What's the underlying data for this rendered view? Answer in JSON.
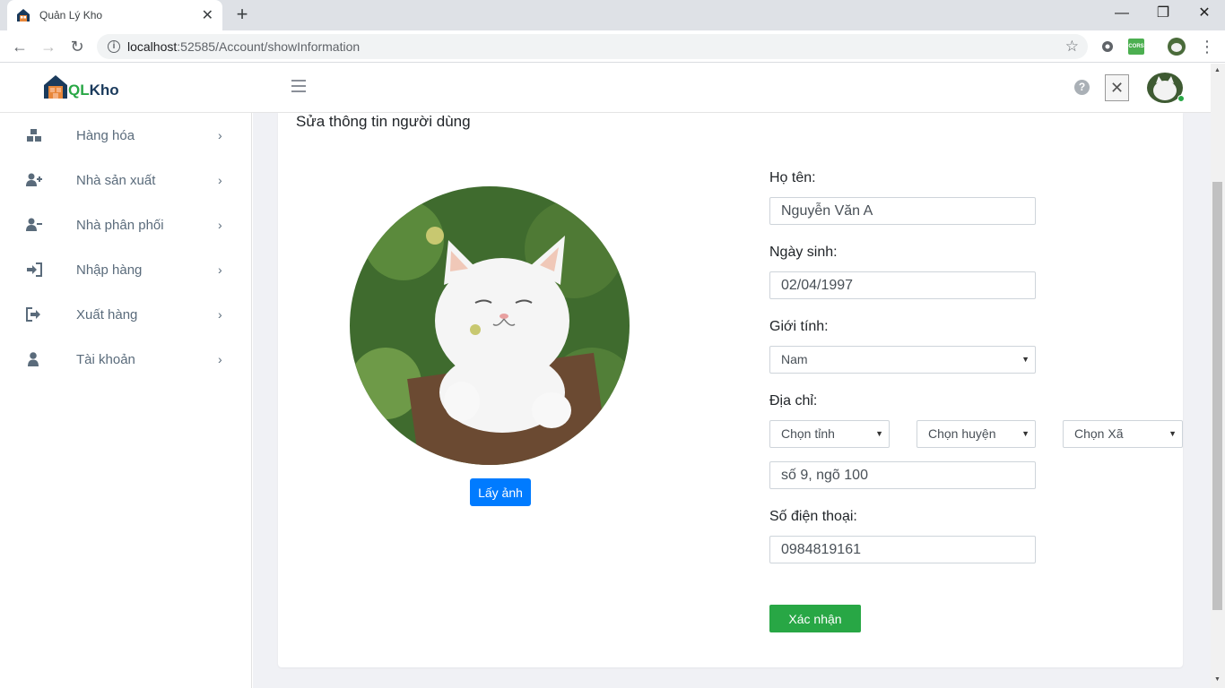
{
  "browser": {
    "tab_title": "Quản Lý Kho",
    "url_host": "localhost",
    "url_path": ":52585/Account/showInformation",
    "new_tab": "+",
    "ext_cors_label": "CORS"
  },
  "header": {
    "logo_q": "QL",
    "logo_k": "Kho",
    "help": "?",
    "close": "✕"
  },
  "sidebar": {
    "items": [
      {
        "label": "Hàng hóa",
        "icon": "boxes-icon"
      },
      {
        "label": "Nhà sản xuất",
        "icon": "user-plus-icon"
      },
      {
        "label": "Nhà phân phối",
        "icon": "user-minus-icon"
      },
      {
        "label": "Nhập hàng",
        "icon": "sign-in-icon"
      },
      {
        "label": "Xuất hàng",
        "icon": "sign-out-icon"
      },
      {
        "label": "Tài khoản",
        "icon": "user-icon"
      }
    ],
    "chevron": "›"
  },
  "form": {
    "title": "Sửa thông tin người dùng",
    "photo_button": "Lấy ảnh",
    "name_label": "Họ tên:",
    "name_value": "Nguyễn Văn A",
    "dob_label": "Ngày sinh:",
    "dob_value": "02/04/1997",
    "gender_label": "Giới tính:",
    "gender_value": "Nam",
    "address_label": "Địa chỉ:",
    "province": "Chọn tỉnh",
    "district": "Chọn huyện",
    "ward": "Chọn Xã",
    "street_value": "số 9, ngõ 100",
    "phone_label": "Số điện thoại:",
    "phone_value": "0984819161",
    "submit": "Xác nhận"
  },
  "colors": {
    "primary": "#007bff",
    "success": "#28a745",
    "sidebar_text": "#5a6b7b",
    "main_bg": "#f0f1f5"
  }
}
